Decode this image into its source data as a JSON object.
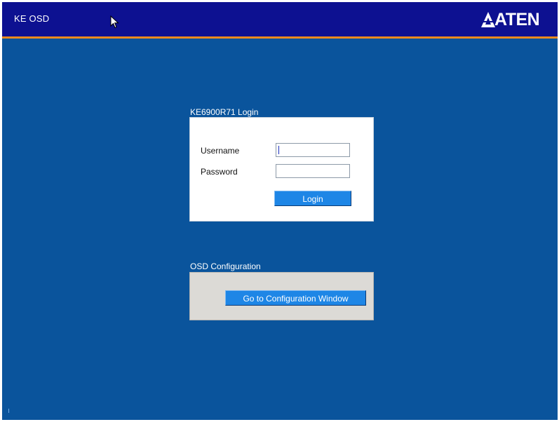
{
  "header": {
    "title": "KE OSD",
    "brand": "ATEN",
    "brand_icon": "aten-triangle-logo-icon",
    "background_color": "#0d1191",
    "accent_line_color": "#ec8a1f"
  },
  "login": {
    "section_title": "KE6900R71 Login",
    "username_label": "Username",
    "username_value": "",
    "password_label": "Password",
    "password_value": "",
    "login_button": "Login"
  },
  "config": {
    "section_title": "OSD Configuration",
    "button": "Go to Configuration Window"
  },
  "colors": {
    "screen_background": "#0a549c",
    "button_background": "#1e86e6",
    "config_panel_background": "#dcdad6"
  }
}
